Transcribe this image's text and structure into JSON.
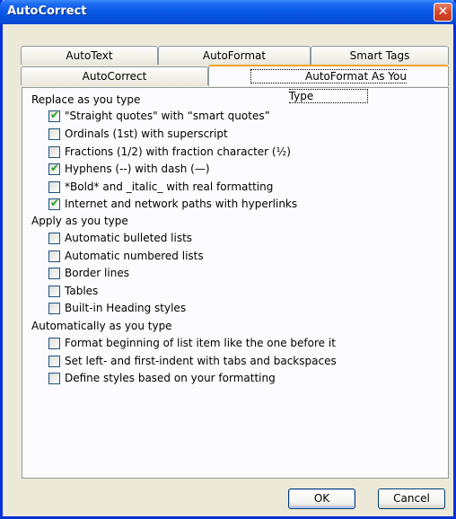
{
  "window": {
    "title": "AutoCorrect",
    "close_glyph": "✕"
  },
  "tabs_back": [
    {
      "label": "AutoText"
    },
    {
      "label": "AutoFormat"
    },
    {
      "label": "Smart Tags"
    }
  ],
  "tabs_front": [
    {
      "label": "AutoCorrect"
    },
    {
      "label": "AutoFormat As You Type"
    }
  ],
  "active_tab": "AutoFormat As You Type",
  "sections": [
    {
      "label": "Replace as you type",
      "options": [
        {
          "label": "\"Straight quotes\" with “smart quotes”",
          "checked": true
        },
        {
          "label": "Ordinals (1st) with superscript",
          "checked": false
        },
        {
          "label": "Fractions (1/2) with fraction character (½)",
          "checked": false
        },
        {
          "label": "Hyphens (--) with dash (—)",
          "checked": true
        },
        {
          "label": "*Bold* and _italic_ with real formatting",
          "checked": false
        },
        {
          "label": "Internet and network paths with hyperlinks",
          "checked": true
        }
      ]
    },
    {
      "label": "Apply as you type",
      "options": [
        {
          "label": "Automatic bulleted lists",
          "checked": false
        },
        {
          "label": "Automatic numbered lists",
          "checked": false
        },
        {
          "label": "Border lines",
          "checked": false
        },
        {
          "label": "Tables",
          "checked": false
        },
        {
          "label": "Built-in Heading styles",
          "checked": false
        }
      ]
    },
    {
      "label": "Automatically as you type",
      "options": [
        {
          "label": "Format beginning of list item like the one before it",
          "checked": false
        },
        {
          "label": "Set left- and first-indent with tabs and backspaces",
          "checked": false
        },
        {
          "label": "Define styles based on your formatting",
          "checked": false
        }
      ]
    }
  ],
  "buttons": {
    "ok": "OK",
    "cancel": "Cancel"
  },
  "colors": {
    "titlebar": "#0a5ae6",
    "close": "#d6492a",
    "check": "#21a121",
    "active_tab_highlight": "#f2a32a"
  },
  "icons": {
    "close": "close-icon",
    "check": "checkmark-icon"
  }
}
